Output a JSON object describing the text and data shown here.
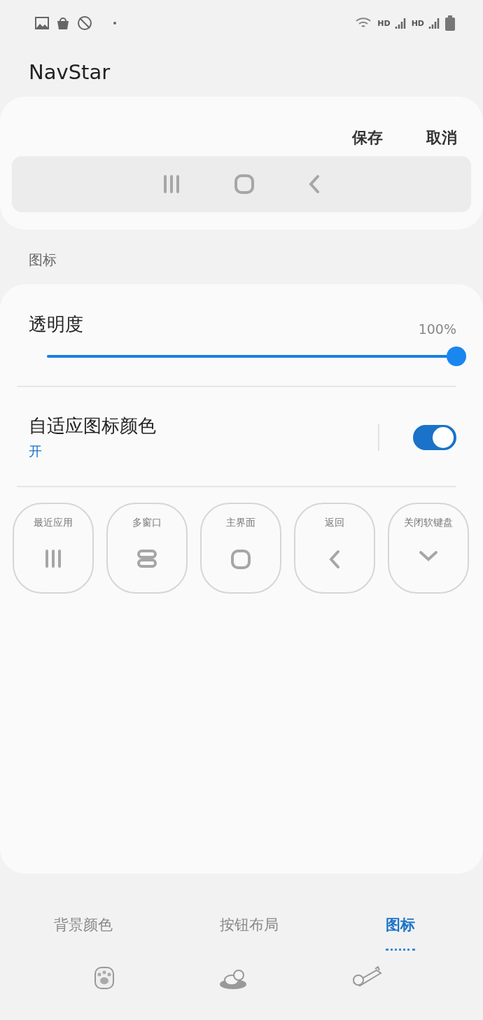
{
  "status_bar": {
    "network_labels": [
      "HD",
      "HD"
    ]
  },
  "app_title": "NavStar",
  "preview": {
    "actions": [
      "保存",
      "取消"
    ],
    "nav_icons": [
      {
        "kind": "recent"
      },
      {
        "kind": "home"
      },
      {
        "kind": "back"
      }
    ]
  },
  "section_label": "图标",
  "opacity": {
    "label": "透明度",
    "reading": "100%",
    "level": 1.0
  },
  "adaptive_color": {
    "label": "自适应图标颜色",
    "status": "开",
    "on": true
  },
  "buttons": [
    {
      "label": "最近应用",
      "kind": "recent"
    },
    {
      "label": "多窗口",
      "kind": "multiwindow"
    },
    {
      "label": "主界面",
      "kind": "home"
    },
    {
      "label": "返回",
      "kind": "back"
    },
    {
      "label": "关闭软键盘",
      "kind": "keyboard"
    }
  ],
  "tabs": [
    {
      "label": "背景颜色",
      "selected": false
    },
    {
      "label": "按钮布局",
      "selected": false
    },
    {
      "label": "图标",
      "selected": true
    }
  ],
  "bottom_icons": [
    {
      "kind": "paw"
    },
    {
      "kind": "dog-bed"
    },
    {
      "kind": "dog-lying"
    }
  ]
}
